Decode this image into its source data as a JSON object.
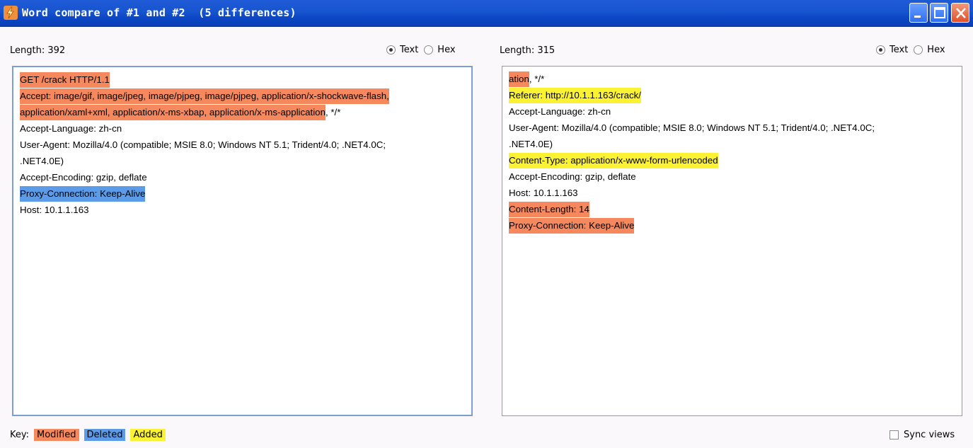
{
  "window": {
    "title": "Word compare of #1 and #2  (5 differences)"
  },
  "left": {
    "length_label": "Length: 392",
    "radio_text": "Text",
    "radio_hex": "Hex",
    "lines": [
      [
        {
          "t": "GET /crack HTTP/1.1",
          "c": "mod"
        }
      ],
      [
        {
          "t": "Accept: image/gif, image/jpeg, image/pjpeg, image/pjpeg, application/x-shockwave-flash,",
          "c": "mod"
        }
      ],
      [
        {
          "t": "application/xaml+xml, application/x-ms-xbap, application/x-ms-application",
          "c": "mod"
        },
        {
          "t": ", */*",
          "c": ""
        }
      ],
      [
        {
          "t": "Accept-Language: zh-cn",
          "c": ""
        }
      ],
      [
        {
          "t": "User-Agent: Mozilla/4.0 (compatible; MSIE 8.0; Windows NT 5.1; Trident/4.0; .NET4.0C;",
          "c": ""
        }
      ],
      [
        {
          "t": ".NET4.0E)",
          "c": ""
        }
      ],
      [
        {
          "t": "Accept-Encoding: gzip, deflate",
          "c": ""
        }
      ],
      [
        {
          "t": "Proxy-Connection: Keep-Alive",
          "c": "del"
        }
      ],
      [
        {
          "t": "Host: 10.1.1.163",
          "c": ""
        }
      ]
    ]
  },
  "right": {
    "length_label": "Length: 315",
    "radio_text": "Text",
    "radio_hex": "Hex",
    "lines": [
      [
        {
          "t": "ation",
          "c": "mod"
        },
        {
          "t": ", */*",
          "c": ""
        }
      ],
      [
        {
          "t": "Referer: http://10.1.1.163/crack/",
          "c": "add"
        }
      ],
      [
        {
          "t": "Accept-Language: zh-cn",
          "c": ""
        }
      ],
      [
        {
          "t": "User-Agent: Mozilla/4.0 (compatible; MSIE 8.0; Windows NT 5.1; Trident/4.0; .NET4.0C;",
          "c": ""
        }
      ],
      [
        {
          "t": ".NET4.0E)",
          "c": ""
        }
      ],
      [
        {
          "t": "Content-Type: application/x-www-form-urlencoded",
          "c": "add"
        }
      ],
      [
        {
          "t": "Accept-Encoding: gzip, deflate",
          "c": ""
        }
      ],
      [
        {
          "t": "Host: 10.1.1.163",
          "c": ""
        }
      ],
      [
        {
          "t": "Content-Length: 14",
          "c": "mod"
        }
      ],
      [
        {
          "t": "Proxy-Connection: Keep-Alive",
          "c": "mod"
        }
      ]
    ]
  },
  "key": {
    "label": "Key:",
    "modified": "Modified",
    "deleted": "Deleted",
    "added": "Added"
  },
  "sync": {
    "label": "Sync views"
  },
  "colors": {
    "modified": "#f5895d",
    "deleted": "#5b9be8",
    "added": "#fbf233"
  }
}
